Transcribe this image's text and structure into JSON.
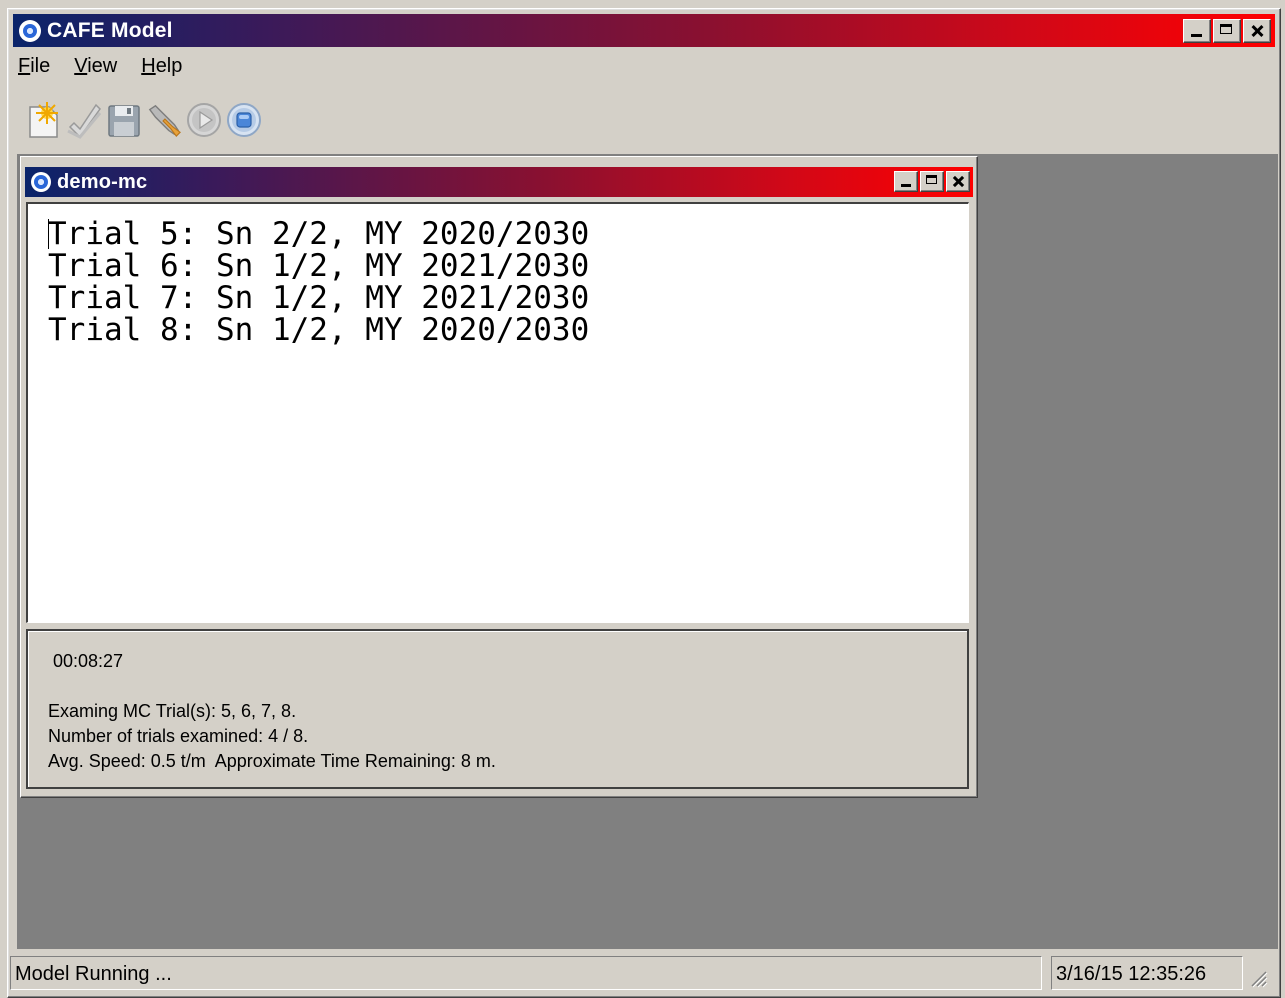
{
  "app": {
    "title": "CAFE Model"
  },
  "menu": {
    "items": [
      {
        "label": "File",
        "underline": "F",
        "rest": "ile"
      },
      {
        "label": "View",
        "underline": "V",
        "rest": "iew"
      },
      {
        "label": "Help",
        "underline": "H",
        "rest": "elp"
      }
    ]
  },
  "toolbar": {
    "buttons": [
      {
        "name": "new-icon"
      },
      {
        "name": "open-icon"
      },
      {
        "name": "save-icon"
      },
      {
        "name": "settings-icon"
      },
      {
        "name": "play-icon"
      },
      {
        "name": "stop-icon"
      }
    ]
  },
  "child": {
    "title": "demo-mc",
    "output_lines": [
      "Trial 5: Sn 2/2, MY 2020/2030",
      "Trial 6: Sn 1/2, MY 2021/2030",
      "Trial 7: Sn 1/2, MY 2021/2030",
      "Trial 8: Sn 1/2, MY 2020/2030"
    ],
    "elapsed": "00:08:27",
    "info": {
      "trials": "Examing MC Trial(s): 5, 6, 7, 8.",
      "count": "Number of trials examined: 4 / 8.",
      "speed": "Avg. Speed: 0.5 t/m  Approximate Time Remaining: 8 m."
    }
  },
  "status": {
    "message": "Model Running ...",
    "datetime": "3/16/15 12:35:26"
  },
  "colors": {
    "titlebar_start": "#0a246a",
    "titlebar_end": "#ff0000",
    "window_face": "#d4d0c8",
    "mdi_background": "#808080"
  }
}
